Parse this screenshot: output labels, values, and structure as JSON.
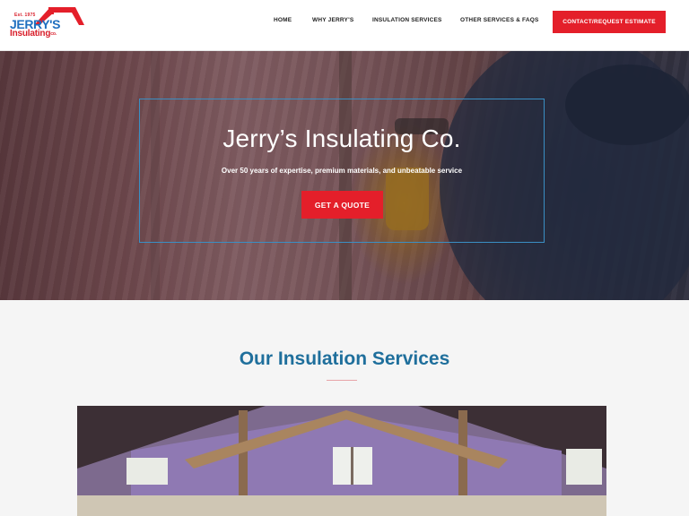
{
  "header": {
    "logo": {
      "est": "Est. 1975",
      "name": "JERRY'S",
      "subname": "Insulating",
      "suffix": "co."
    },
    "nav": [
      {
        "label": "HOME"
      },
      {
        "label": "WHY JERRY'S"
      },
      {
        "label": "INSULATION SERVICES"
      },
      {
        "label": "OTHER SERVICES & FAQS"
      }
    ],
    "cta_label": "CONTACT/REQUEST ESTIMATE"
  },
  "hero": {
    "title": "Jerry’s Insulating Co.",
    "subtitle": "Over 50 years of expertise, premium materials, and unbeatable service",
    "button_label": "GET A QUOTE"
  },
  "services": {
    "title": "Our Insulation Services"
  },
  "colors": {
    "accent_red": "#e41f2a",
    "brand_blue": "#1f6f9c"
  }
}
